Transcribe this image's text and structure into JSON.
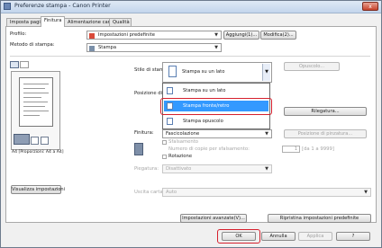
{
  "window": {
    "title": "Preferenze stampa - Canon Printer",
    "close_label": "x"
  },
  "tabs": [
    {
      "label": "Imposta pagina"
    },
    {
      "label": "Finitura"
    },
    {
      "label": "Alimentazione carta"
    },
    {
      "label": "Qualità"
    }
  ],
  "profile": {
    "label": "Profilo:",
    "value": "Impostazioni predefinite",
    "add_button": "Aggiungi(1)...",
    "edit_button": "Modifica(2)..."
  },
  "output_method": {
    "label": "Metodo di stampa:",
    "value": "Stampa"
  },
  "print_style": {
    "label": "Stile di stampa:",
    "value": "Stampa su un lato",
    "options": [
      "Stampa su un lato",
      "Stampa fronte/retro",
      "Stampa opuscolo"
    ],
    "selected_index": 1,
    "booklet_button": "Opuscolo..."
  },
  "binding": {
    "label": "Posizione di rilegatura:",
    "button": "Rilegatura..."
  },
  "finishing": {
    "label": "Finitura:",
    "value": "Fascicolazione",
    "position_button": "Posizione di pinzatura...",
    "offset_label": "Sfalsamento",
    "copies_label": "Numero di copie per sfalsamento:",
    "copies_value": "1",
    "copies_range": "[da 1 a 9999]",
    "rotation_label": "Rotazione"
  },
  "fold": {
    "label": "Piegatura:",
    "value": "Disattivato"
  },
  "output_tray": {
    "label": "Uscita carta(R):",
    "value": "Auto"
  },
  "preview": {
    "caption": "A4 [Proporzioni: A4 a A4]",
    "view_settings_button": "Visualizza impostazioni"
  },
  "footer": {
    "advanced_button": "Impostazioni avanzate(V)...",
    "restore_button": "Ripristina impostazioni predefinite",
    "ok_button": "OK",
    "cancel_button": "Annulla",
    "apply_button": "Applica",
    "help_button": "?"
  },
  "colors": {
    "selection": "#3399ff",
    "highlight": "#d6202d",
    "titlebar": "#c3d5ec"
  }
}
